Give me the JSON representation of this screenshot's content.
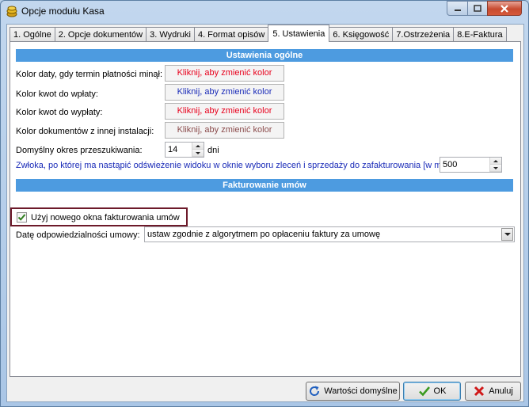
{
  "window": {
    "title": "Opcje modułu Kasa",
    "icon": "cash-module-icon"
  },
  "tabs": [
    {
      "label": "1. Ogólne",
      "active": false
    },
    {
      "label": "2. Opcje dokumentów",
      "active": false
    },
    {
      "label": "3. Wydruki",
      "active": false
    },
    {
      "label": "4. Format opisów",
      "active": false
    },
    {
      "label": "5. Ustawienia",
      "active": true
    },
    {
      "label": "6. Księgowość",
      "active": false
    },
    {
      "label": "7.Ostrzeżenia",
      "active": false
    },
    {
      "label": "8.E-Faktura",
      "active": false
    }
  ],
  "general": {
    "header": "Ustawienia ogólne",
    "color_rows": [
      {
        "label": "Kolor daty, gdy termin płatności minął:",
        "button": "Kliknij, aby zmienić kolor",
        "color": "#e8001c"
      },
      {
        "label": "Kolor kwot do wpłaty:",
        "button": "Kliknij, aby zmienić kolor",
        "color": "#1a2bb8"
      },
      {
        "label": "Kolor kwot do wypłaty:",
        "button": "Kliknij, aby zmienić kolor",
        "color": "#e8001c"
      },
      {
        "label": "Kolor dokumentów z innej instalacji:",
        "button": "Kliknij, aby zmienić kolor",
        "color": "#8a4a4a"
      }
    ],
    "search_period_label": "Domyślny okres przeszukiwania:",
    "search_period_value": "14",
    "search_period_unit": "dni",
    "refresh_delay_label": "Zwłoka, po której ma nastąpić odświeżenie widoku w oknie wyboru zleceń i sprzedaży do zafakturowania [w ms]",
    "refresh_delay_value": "500"
  },
  "invoicing": {
    "header": "Fakturowanie umów",
    "use_new_window_label": "Użyj nowego okna fakturowania umów",
    "use_new_window_checked": true,
    "responsibility_date_label": "Datę odpowiedzialności umowy:",
    "responsibility_date_value": "ustaw zgodnie z algorytmem po opłaceniu faktury za umowę"
  },
  "buttons": {
    "defaults": "Wartości domyślne",
    "ok": "OK",
    "cancel": "Anuluj"
  },
  "colors": {
    "header_bg": "#4d9be0",
    "highlight_border": "#6d1a2a",
    "blue_text": "#1a2bb8"
  }
}
